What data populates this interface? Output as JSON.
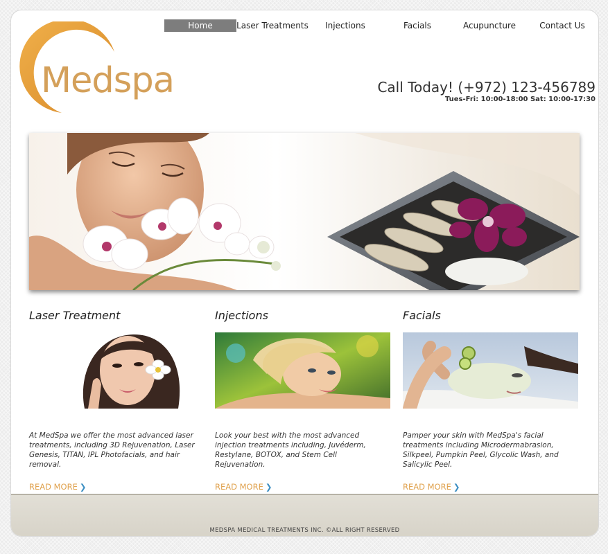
{
  "nav": {
    "items": [
      {
        "label": "Home",
        "active": true
      },
      {
        "label": "Laser Treatments",
        "active": false
      },
      {
        "label": "Injections",
        "active": false
      },
      {
        "label": "Facials",
        "active": false
      },
      {
        "label": "Acupuncture",
        "active": false
      },
      {
        "label": "Contact Us",
        "active": false
      }
    ]
  },
  "logo": {
    "text": "Medspa",
    "color": "#d4a05a",
    "ring_color": "#e39a2f"
  },
  "contact": {
    "call": "Call Today! (+972) 123-456789",
    "hours": "Tues-Fri: 10:00-18:00 Sat: 10:00-17:30"
  },
  "sections": [
    {
      "title": "Laser Treatment",
      "text": "At MedSpa we offer the most advanced laser treatments, including 3D Rejuvenation, Laser Genesis, TITAN, IPL Photofacials, and hair removal.",
      "read_more": "READ MORE"
    },
    {
      "title": "Injections",
      "text": "Look your best with the most advanced injection treatments including, Juvéderm, Restylane, BOTOX, and Stem Cell Rejuvenation.",
      "read_more": "READ MORE"
    },
    {
      "title": "Facials",
      "text": "Pamper your skin with MedSpa's facial treatments including Microdermabrasion, Silkpeel, Pumpkin Peel, Glycolic Wash, and Salicylic Peel.",
      "read_more": "READ MORE"
    }
  ],
  "footer": {
    "text": "MEDSPA MEDICAL TREATMENTS INC. ©ALL RIGHT RESERVED"
  },
  "colors": {
    "accent": "#e0a24e",
    "chevron": "#3d8fc3",
    "nav_active_bg": "#7d7d7d"
  }
}
